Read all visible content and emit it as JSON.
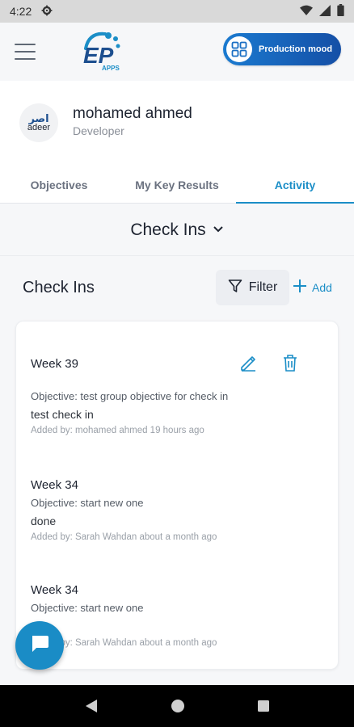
{
  "status_bar": {
    "time": "4:22"
  },
  "header": {
    "mode_label": "Production mood",
    "logo_text": "APPS"
  },
  "profile": {
    "name": "mohamed ahmed",
    "role": "Developer",
    "avatar_top": "اصر",
    "avatar_bottom": "adeer"
  },
  "tabs": [
    {
      "label": "Objectives",
      "active": false
    },
    {
      "label": "My Key Results",
      "active": false
    },
    {
      "label": "Activity",
      "active": true
    }
  ],
  "selector": {
    "label": "Check Ins"
  },
  "section": {
    "title": "Check Ins",
    "filter_label": "Filter",
    "add_label": "Add"
  },
  "checkins": [
    {
      "week": "Week 39",
      "objective": "Objective: test group objective for check in",
      "note": "test check in",
      "added_by": "Added by: mohamed ahmed  19 hours ago"
    },
    {
      "week": "Week 34",
      "objective": "Objective: start new one",
      "note": "done",
      "added_by": "Added by: Sarah Wahdan about a month ago"
    },
    {
      "week": "Week 34",
      "objective": "Objective: start new one",
      "added_by": "Added by: Sarah Wahdan about a month ago"
    }
  ],
  "colors": {
    "accent": "#1b8ec7",
    "mode_button": "#1a7ad0",
    "fab": "#1a8cc6"
  },
  "icons": [
    "menu-icon",
    "settings-icon",
    "wifi-icon",
    "signal-icon",
    "battery-icon",
    "grid-icon",
    "chevron-down-icon",
    "filter-icon",
    "plus-icon",
    "edit-icon",
    "delete-icon",
    "chat-icon",
    "back-icon",
    "home-icon",
    "recents-icon"
  ]
}
